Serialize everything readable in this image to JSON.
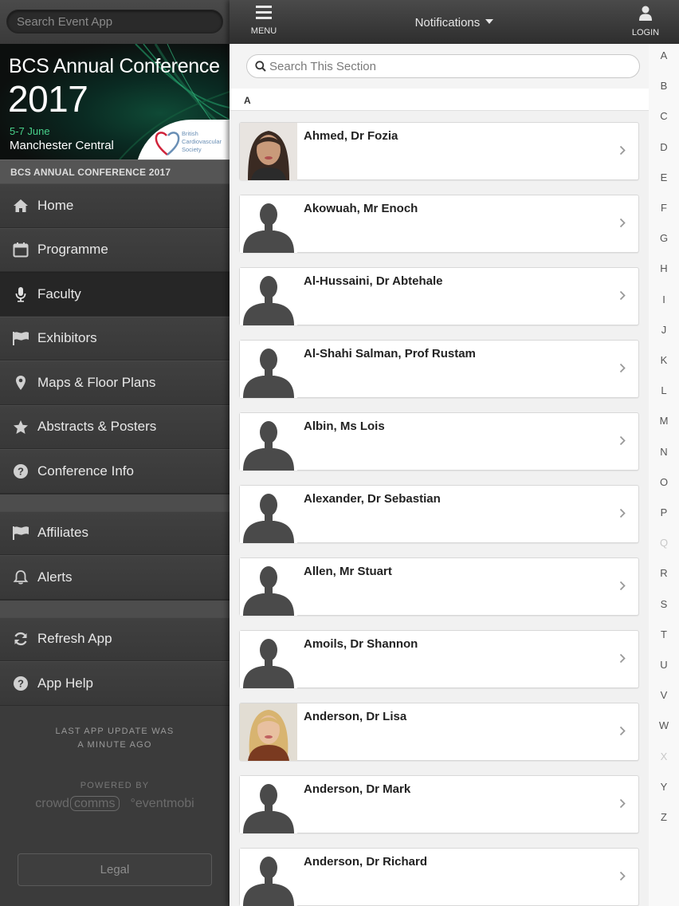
{
  "sidebar": {
    "search_placeholder": "Search Event App",
    "banner": {
      "title_line1": "BCS Annual Conference",
      "title_line2": "2017",
      "dates": "5-7 June",
      "venue": "Manchester Central",
      "logo_text": [
        "British",
        "Cardiovascular",
        "Society"
      ]
    },
    "section_header": "BCS ANNUAL CONFERENCE 2017",
    "items": [
      {
        "label": "Home",
        "icon": "home-icon"
      },
      {
        "label": "Programme",
        "icon": "calendar-icon"
      },
      {
        "label": "Faculty",
        "icon": "microphone-icon",
        "active": true
      },
      {
        "label": "Exhibitors",
        "icon": "flag-icon"
      },
      {
        "label": "Maps & Floor Plans",
        "icon": "map-pin-icon"
      },
      {
        "label": "Abstracts & Posters",
        "icon": "star-icon"
      },
      {
        "label": "Conference Info",
        "icon": "question-circle-icon"
      }
    ],
    "items2": [
      {
        "label": "Affiliates",
        "icon": "flag-icon"
      },
      {
        "label": "Alerts",
        "icon": "bell-icon"
      }
    ],
    "items3": [
      {
        "label": "Refresh App",
        "icon": "refresh-icon"
      },
      {
        "label": "App Help",
        "icon": "question-circle-icon"
      }
    ],
    "update_line1": "LAST APP UPDATE WAS",
    "update_line2": "A MINUTE AGO",
    "powered_by": "POWERED BY",
    "logo_crowd": "crowd",
    "logo_comms": "comms",
    "logo_eventmobi": "eventmobi",
    "legal_label": "Legal"
  },
  "topbar": {
    "menu_label": "MENU",
    "title": "Notifications",
    "login_label": "LOGIN"
  },
  "main": {
    "search_placeholder": "Search This Section",
    "letter_header": "A",
    "people": [
      {
        "name": "Ahmed, Dr Fozia",
        "photo": "photo-dark-hair"
      },
      {
        "name": "Akowuah, Mr Enoch",
        "photo": "placeholder"
      },
      {
        "name": "Al-Hussaini, Dr Abtehale",
        "photo": "placeholder"
      },
      {
        "name": "Al-Shahi Salman, Prof Rustam",
        "photo": "placeholder"
      },
      {
        "name": "Albin, Ms Lois",
        "photo": "placeholder"
      },
      {
        "name": "Alexander, Dr Sebastian",
        "photo": "placeholder"
      },
      {
        "name": "Allen, Mr Stuart",
        "photo": "placeholder"
      },
      {
        "name": "Amoils, Dr Shannon",
        "photo": "placeholder"
      },
      {
        "name": "Anderson, Dr Lisa",
        "photo": "photo-blonde"
      },
      {
        "name": "Anderson, Dr Mark",
        "photo": "placeholder"
      },
      {
        "name": "Anderson, Dr Richard",
        "photo": "placeholder"
      }
    ]
  },
  "alphabet": [
    "A",
    "B",
    "C",
    "D",
    "E",
    "F",
    "G",
    "H",
    "I",
    "J",
    "K",
    "L",
    "M",
    "N",
    "O",
    "P",
    "Q",
    "R",
    "S",
    "T",
    "U",
    "V",
    "W",
    "X",
    "Y",
    "Z"
  ],
  "alphabet_dim": [
    "Q",
    "X"
  ],
  "colors": {
    "accent_green": "#48d08a",
    "sidebar_bg": "#3b3b3b",
    "topbar_bg": "#2e2e2e",
    "list_bg": "#f1f1f1",
    "logo_red": "#d0233a",
    "logo_blue": "#6a8fb5"
  }
}
